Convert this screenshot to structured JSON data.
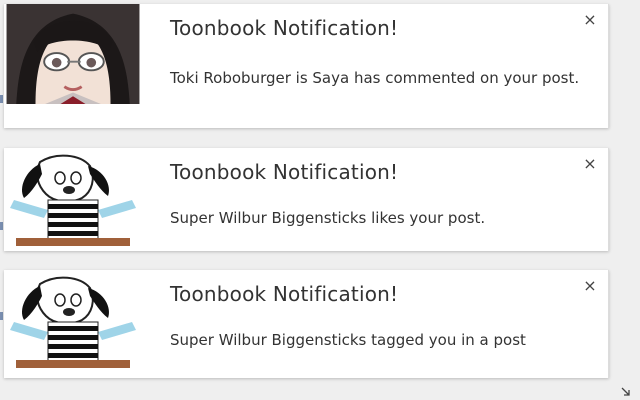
{
  "notifications": [
    {
      "title": "Toonbook Notification!",
      "message": "Toki Roboburger is Saya has commented on your post.",
      "avatar": "anime-girl-avatar",
      "close_icon": "×"
    },
    {
      "title": "Toonbook Notification!",
      "message": "Super Wilbur Biggensticks likes your post.",
      "avatar": "cartoon-dog-avatar",
      "close_icon": "×"
    },
    {
      "title": "Toonbook Notification!",
      "message": "Super Wilbur Biggensticks tagged you in a post",
      "avatar": "cartoon-dog-avatar",
      "close_icon": "×"
    }
  ],
  "colors": {
    "card_bg": "#ffffff",
    "page_bg": "#efefef",
    "text": "#333333"
  }
}
